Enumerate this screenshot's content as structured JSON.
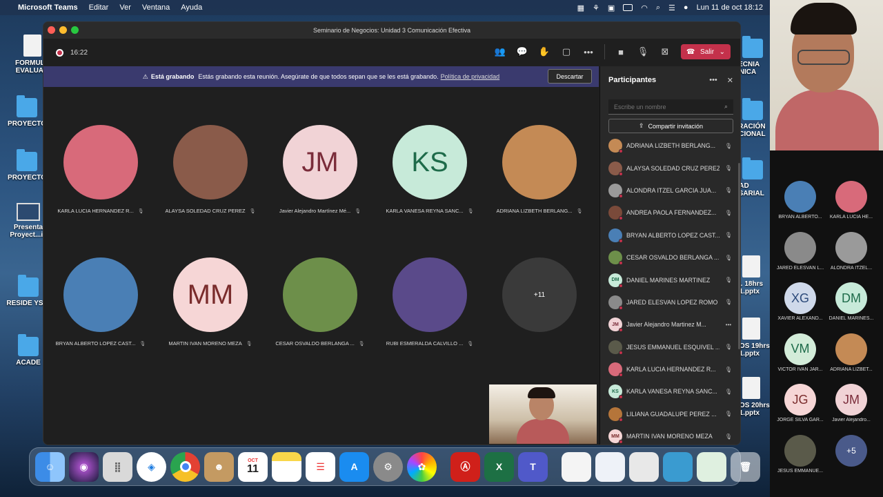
{
  "menubar": {
    "app_name": "Microsoft Teams",
    "menus": [
      "Editar",
      "Ver",
      "Ventana",
      "Ayuda"
    ],
    "datetime": "Lun 11 de oct  18:12"
  },
  "desktop": {
    "icons": [
      "FORMULA EVALUA...",
      "PROYECTO",
      "PROYECTO",
      "Presenta Proyect...ic",
      "RESIDE YSID",
      "ACADE"
    ],
    "right_icons": [
      "TECNIA ÓNICA",
      "TRACIÓN ACIONAL",
      "DAD ESARIAL",
      "G. 18hrs 21.pptx",
      "TOS 19hrs 21.pptx",
      "TOS 20hrs 21.pptx"
    ]
  },
  "window": {
    "title": "Seminario de Negocios: Unidad 3 Comunicación Efectiva",
    "timer": "16:22",
    "leave_label": "Salir"
  },
  "banner": {
    "heading": "Está grabando",
    "message": "Estás grabando esta reunión. Asegúrate de que todos sepan que se les está grabando.",
    "link": "Política de privacidad",
    "dismiss": "Descartar"
  },
  "gallery": [
    {
      "name": "KARLA LUCIA HERNANDEZ R...",
      "initials": "",
      "color": "#d86a7a"
    },
    {
      "name": "ALAYSA SOLEDAD CRUZ PEREZ",
      "initials": "",
      "color": "#8a5b4a"
    },
    {
      "name": "Javier Alejandro Martínez Mé...",
      "initials": "JM",
      "color": "#f1d3d6",
      "text_color": "#7a2c3a"
    },
    {
      "name": "KARLA VANESA REYNA SANC...",
      "initials": "KS",
      "color": "#c7ead9",
      "text_color": "#1e6b4a"
    },
    {
      "name": "ADRIANA LIZBETH BERLANG...",
      "initials": "",
      "color": "#c48a55"
    },
    {
      "name": "BRYAN ALBERTO LOPEZ CAST...",
      "initials": "",
      "color": "#4a7fb5"
    },
    {
      "name": "MARTIN IVAN MORENO MEZA",
      "initials": "MM",
      "color": "#f6d6d6",
      "text_color": "#7a2c2c"
    },
    {
      "name": "CESAR OSVALDO BERLANGA ...",
      "initials": "",
      "color": "#6d8f4a"
    },
    {
      "name": "RUBI ESMERALDA CALVILLO ...",
      "initials": "",
      "color": "#5a4a8a"
    },
    {
      "name": "",
      "initials": "+11",
      "color": "#3a3a3a",
      "text_color": "#ffffff"
    }
  ],
  "panel": {
    "title": "Participantes",
    "search_placeholder": "Escribe un nombre",
    "share_label": "Compartir invitación",
    "participants": [
      {
        "name": "ADRIANA LIZBETH BERLANG...",
        "initials": "",
        "color": "#c48a55",
        "mic": "off"
      },
      {
        "name": "ALAYSA SOLEDAD CRUZ PEREZ",
        "initials": "",
        "color": "#8a5b4a",
        "mic": "off"
      },
      {
        "name": "ALONDRA ITZEL GARCIA JUA...",
        "initials": "",
        "color": "#9a9a9a",
        "mic": "off"
      },
      {
        "name": "ANDREA PAOLA FERNANDEZ...",
        "initials": "",
        "color": "#7a4a3a",
        "mic": "off"
      },
      {
        "name": "BRYAN ALBERTO LOPEZ CAST...",
        "initials": "",
        "color": "#4a7fb5",
        "mic": "off"
      },
      {
        "name": "CESAR OSVALDO BERLANGA ...",
        "initials": "",
        "color": "#6d8f4a",
        "mic": "off"
      },
      {
        "name": "DANIEL MARINES MARTINEZ",
        "initials": "DM",
        "color": "#c7ead9",
        "text_color": "#1e6b4a",
        "mic": "off"
      },
      {
        "name": "JARED ELESVAN LOPEZ ROMO",
        "initials": "",
        "color": "#8a8a8a",
        "mic": "off"
      },
      {
        "name": "Javier Alejandro Martinez M...",
        "initials": "JM",
        "color": "#f1d3d6",
        "text_color": "#7a2c3a",
        "mic": "more"
      },
      {
        "name": "JESUS EMMANUEL ESQUIVEL ...",
        "initials": "",
        "color": "#5a5a4a",
        "mic": "off"
      },
      {
        "name": "KARLA LUCIA HERNANDEZ R...",
        "initials": "",
        "color": "#d86a7a",
        "mic": "off"
      },
      {
        "name": "KARLA VANESA REYNA SANC...",
        "initials": "KS",
        "color": "#c7ead9",
        "text_color": "#1e6b4a",
        "mic": "off"
      },
      {
        "name": "LILIANA GUADALUPE PEREZ ...",
        "initials": "",
        "color": "#b5753a",
        "mic": "off"
      },
      {
        "name": "MARTIN IVAN MORENO MEZA",
        "initials": "MM",
        "color": "#f6d6d6",
        "text_color": "#7a2c2c",
        "mic": "off"
      }
    ]
  },
  "sidebar": [
    {
      "name": "BRYAN ALBERTO...",
      "initials": "",
      "color": "#4a7fb5"
    },
    {
      "name": "KARLA LUCIA HE...",
      "initials": "",
      "color": "#d86a7a"
    },
    {
      "name": "JARED ELESVAN L...",
      "initials": "",
      "color": "#8a8a8a"
    },
    {
      "name": "ALONDRA ITZEL...",
      "initials": "",
      "color": "#9a9a9a"
    },
    {
      "name": "XAVIER ALEXAND...",
      "initials": "XG",
      "color": "#cfd9ea",
      "text_color": "#2c4a7a"
    },
    {
      "name": "DANIEL MARINES...",
      "initials": "DM",
      "color": "#c7ead9",
      "text_color": "#1e6b4a"
    },
    {
      "name": "VICTOR IVAN JAR...",
      "initials": "VM",
      "color": "#d3ecd9",
      "text_color": "#1e6b4a"
    },
    {
      "name": "ADRIANA LIZBET...",
      "initials": "",
      "color": "#c48a55"
    },
    {
      "name": "JORGE SILVA GAR...",
      "initials": "JG",
      "color": "#f6d6d6",
      "text_color": "#7a2c2c"
    },
    {
      "name": "Javier Alejandro...",
      "initials": "JM",
      "color": "#f1d3d6",
      "text_color": "#7a2c3a"
    },
    {
      "name": "JESUS EMMANUE...",
      "initials": "",
      "color": "#5a5a4a"
    },
    {
      "name": "",
      "initials": "+5",
      "color": "#4a5a8a",
      "text_color": "#ffffff"
    }
  ],
  "dock": {
    "calendar_month": "OCT",
    "calendar_day": "11",
    "apps": [
      "Finder",
      "Siri",
      "Launchpad",
      "Safari",
      "Chrome",
      "Contacts",
      "Calendar",
      "Notes",
      "Reminders",
      "App Store",
      "System Preferences",
      "Photos",
      "Acrobat",
      "Excel",
      "Teams"
    ]
  }
}
